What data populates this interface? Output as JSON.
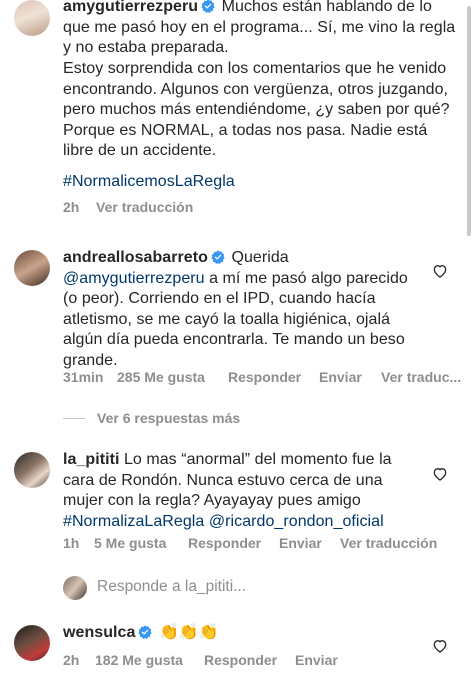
{
  "comments": [
    {
      "username": "amygutierrezperu",
      "verified": true,
      "text_p1": "Muchos están hablando de lo que me pasó hoy en el programa... Sí, me vino la regla y no estaba preparada.",
      "text_p2": "Estoy sorprendida con los comentarios que he venido encontrando. Algunos con vergüenza, otros juzgando, pero muchos más entendiéndome, ¿y saben por qué? Porque es NORMAL, a todas nos pasa. Nadie está libre de un accidente.",
      "hashtag": "#NormalicemosLaRegla",
      "time": "2h",
      "translate": "Ver traducción"
    },
    {
      "username": "andreallosabarreto",
      "verified": true,
      "prefix": "Querida",
      "mention": "@amygutierrezperu",
      "text": "a mí me pasó algo parecido (o peor). Corriendo en el IPD, cuando hacía atletismo, se me cayó la toalla higiénica, ojalá algún día pueda encontrarla. Te mando un beso grande.",
      "time": "31min",
      "likes": "285 Me gusta",
      "reply": "Responder",
      "send": "Enviar",
      "translate": "Ver traduc..."
    },
    {
      "username": "la_pititi",
      "text": "Lo mas “anormal” del momento fue la cara de Rondón. Nunca estuvo cerca de una mujer con la regla? Ayayayay pues amigo",
      "hashtag": "#NormalizaLaRegla",
      "mention": "@ricardo_rondon_oficial",
      "time": "1h",
      "likes": "5 Me gusta",
      "reply": "Responder",
      "send": "Enviar",
      "translate": "Ver traducción"
    },
    {
      "username": "wensulca",
      "verified": true,
      "emoji": "👏👏👏",
      "time": "2h",
      "likes": "182 Me gusta",
      "reply": "Responder",
      "send": "Enviar"
    }
  ],
  "view_replies": "Ver 6 respuestas más",
  "reply_box_placeholder": "Responde a la_pititi...",
  "colors": {
    "link": "#00376b",
    "meta": "#8e8e8e",
    "verified": "#3897f0"
  },
  "icons": [
    "heart-icon",
    "verified-badge-icon",
    "avatar"
  ]
}
